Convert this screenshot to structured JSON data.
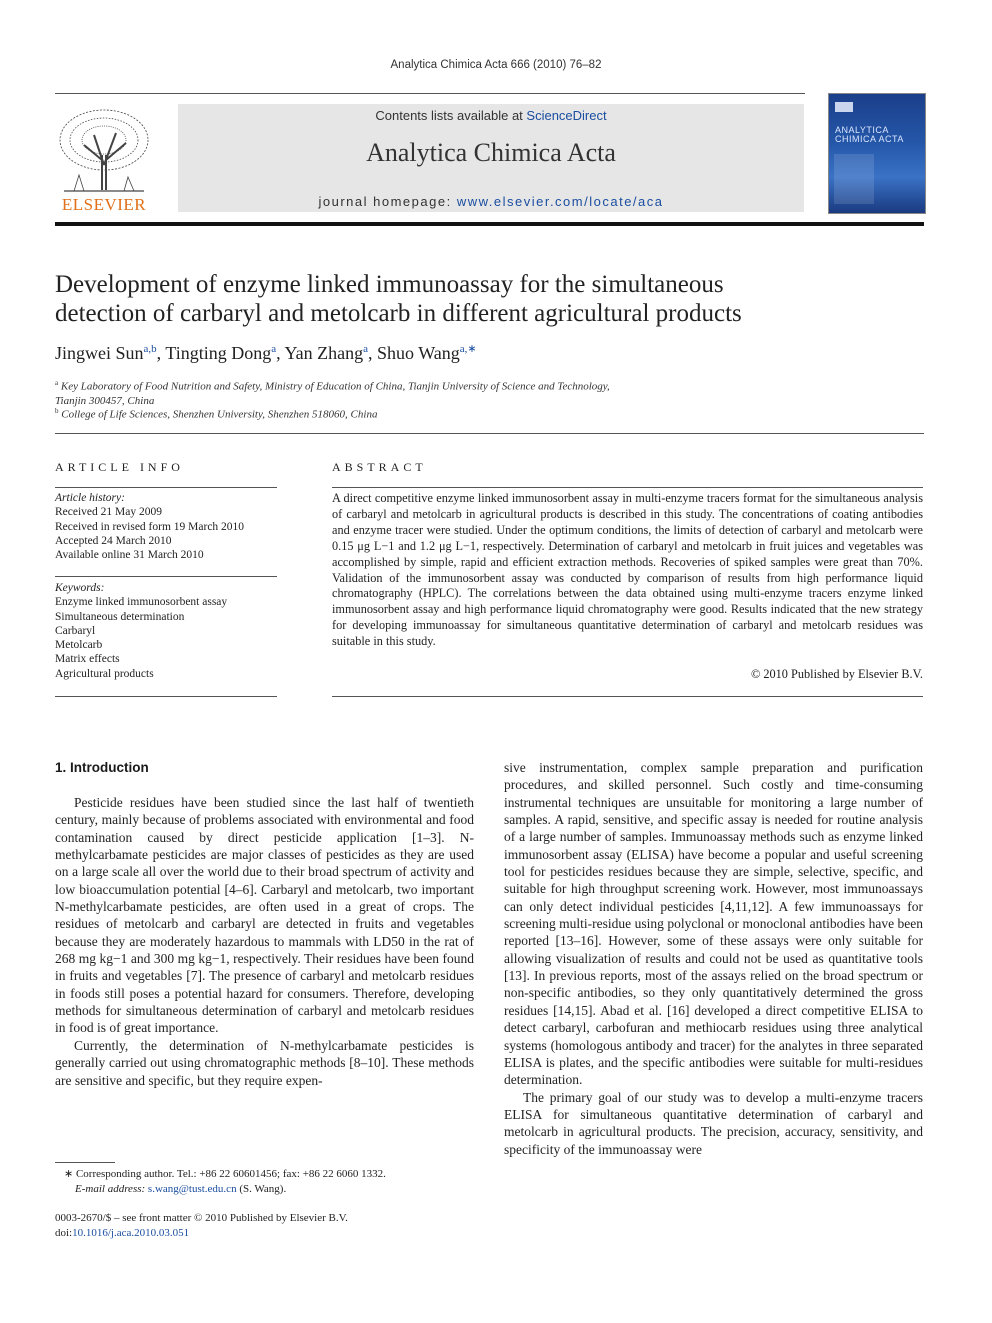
{
  "running_head": "Analytica Chimica Acta 666 (2010) 76–82",
  "masthead": {
    "publisher_logo_text": "ELSEVIER",
    "contents_prefix": "Contents lists available at ",
    "contents_link": "ScienceDirect",
    "journal_title": "Analytica Chimica Acta",
    "homepage_prefix": "journal homepage: ",
    "homepage_link": "www.elsevier.com/locate/aca",
    "cover_title_1": "ANALYTICA",
    "cover_title_2": "CHIMICA ACTA"
  },
  "article": {
    "title_line1": "Development of enzyme linked immunoassay for the simultaneous",
    "title_line2": "detection of carbaryl and metolcarb in different agricultural products",
    "authors": [
      {
        "name": "Jingwei Sun",
        "sup": "a,b",
        "sep": ", "
      },
      {
        "name": "Tingting Dong",
        "sup": "a",
        "sep": ", "
      },
      {
        "name": "Yan Zhang",
        "sup": "a",
        "sep": ", "
      },
      {
        "name": "Shuo Wang",
        "sup": "a,∗",
        "sep": ""
      }
    ],
    "affiliations": [
      {
        "sup": "a",
        "line1": "Key Laboratory of Food Nutrition and Safety, Ministry of Education of China, Tianjin University of Science and Technology,",
        "line2": "Tianjin 300457, China"
      },
      {
        "sup": "b",
        "line1": "College of Life Sciences, Shenzhen University, Shenzhen 518060, China",
        "line2": ""
      }
    ]
  },
  "article_info": {
    "heading": "ARTICLE INFO",
    "history_label": "Article history:",
    "history": [
      "Received 21 May 2009",
      "Received in revised form 19 March 2010",
      "Accepted 24 March 2010",
      "Available online 31 March 2010"
    ],
    "keywords_label": "Keywords:",
    "keywords": [
      "Enzyme linked immunosorbent assay",
      "Simultaneous determination",
      "Carbaryl",
      "Metolcarb",
      "Matrix effects",
      "Agricultural products"
    ]
  },
  "abstract": {
    "heading": "ABSTRACT",
    "text": "A direct competitive enzyme linked immunosorbent assay in multi-enzyme tracers format for the simultaneous analysis of carbaryl and metolcarb in agricultural products is described in this study. The concentrations of coating antibodies and enzyme tracer were studied. Under the optimum conditions, the limits of detection of carbaryl and metolcarb were 0.15 μg L−1 and 1.2 μg L−1, respectively. Determination of carbaryl and metolcarb in fruit juices and vegetables was accomplished by simple, rapid and efficient extraction methods. Recoveries of spiked samples were great than 70%. Validation of the immunosorbent assay was conducted by comparison of results from high performance liquid chromatography (HPLC). The correlations between the data obtained using multi-enzyme tracers enzyme linked immunosorbent assay and high performance liquid chromatography were good. Results indicated that the new strategy for developing immunoassay for simultaneous quantitative determination of carbaryl and metolcarb residues was suitable in this study.",
    "copyright": "© 2010 Published by Elsevier B.V."
  },
  "introduction": {
    "heading": "1.  Introduction",
    "left_paragraphs": [
      "Pesticide residues have been studied since the last half of twentieth century, mainly because of problems associated with environmental and food contamination caused by direct pesticide application [1–3]. N-methylcarbamate pesticides are major classes of pesticides as they are used on a large scale all over the world due to their broad spectrum of activity and low bioaccumulation potential [4–6]. Carbaryl and metolcarb, two important N-methylcarbamate pesticides, are often used in a great of crops. The residues of metolcarb and carbaryl are detected in fruits and vegetables because they are moderately hazardous to mammals with LD50 in the rat of 268 mg kg−1 and 300 mg kg−1, respectively. Their residues have been found in fruits and vegetables [7]. The presence of carbaryl and metolcarb residues in foods still poses a potential hazard for consumers. Therefore, developing methods for simultaneous determination of carbaryl and metolcarb residues in food is of great importance.",
      "Currently, the determination of N-methylcarbamate pesticides is generally carried out using chromatographic methods [8–10]. These methods are sensitive and specific, but they require expen-"
    ],
    "right_paragraphs": [
      "sive instrumentation, complex sample preparation and purification procedures, and skilled personnel. Such costly and time-consuming instrumental techniques are unsuitable for monitoring a large number of samples. A rapid, sensitive, and specific assay is needed for routine analysis of a large number of samples. Immunoassay methods such as enzyme linked immunosorbent assay (ELISA) have become a popular and useful screening tool for pesticides residues because they are simple, selective, specific, and suitable for high throughput screening work. However, most immunoassays can only detect individual pesticides [4,11,12]. A few immunoassays for screening multi-residue using polyclonal or monoclonal antibodies have been reported [13–16]. However, some of these assays were only suitable for allowing visualization of results and could not be used as quantitative tools [13]. In previous reports, most of the assays relied on the broad spectrum or non-specific antibodies, so they only quantitatively determined the gross residues [14,15]. Abad et al. [16] developed a direct competitive ELISA to detect carbaryl, carbofuran and methiocarb residues using three analytical systems (homologous antibody and tracer) for the analytes in three separated ELISA is plates, and the specific antibodies were suitable for multi-residues determination.",
      "The primary goal of our study was to develop a multi-enzyme tracers ELISA for simultaneous quantitative determination of carbaryl and metolcarb in agricultural products. The precision, accuracy, sensitivity, and specificity of the immunoassay were"
    ]
  },
  "footnotes": {
    "corresponding": "∗  Corresponding author. Tel.: +86 22 60601456; fax: +86 22 6060 1332.",
    "email_label": "E-mail address: ",
    "email": "s.wang@tust.edu.cn",
    "email_suffix": " (S. Wang).",
    "issn": "0003-2670/$ – see front matter © 2010 Published by Elsevier B.V.",
    "doi_label": "doi:",
    "doi": "10.1016/j.aca.2010.03.051"
  }
}
